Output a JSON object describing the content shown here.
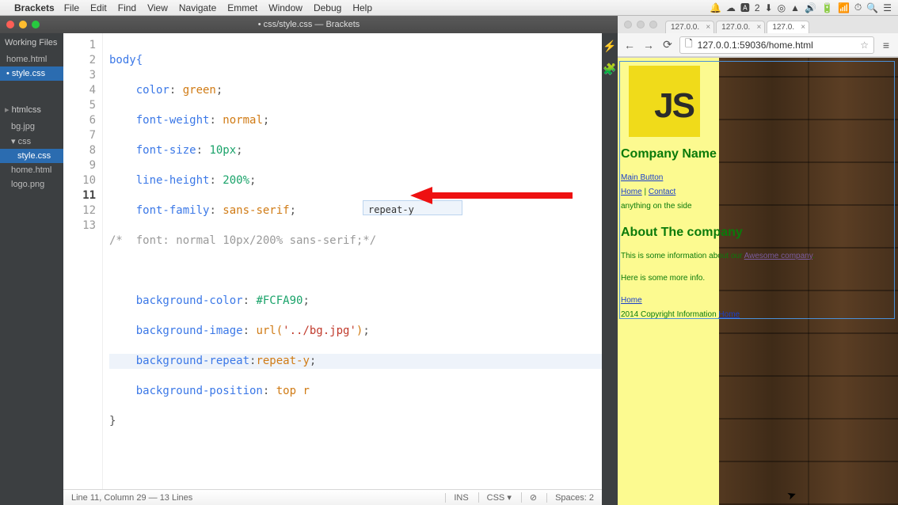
{
  "menubar": {
    "appname": "Brackets",
    "items": [
      "File",
      "Edit",
      "Find",
      "View",
      "Navigate",
      "Emmet",
      "Window",
      "Debug",
      "Help"
    ]
  },
  "window": {
    "title": "• css/style.css — Brackets"
  },
  "sidebar": {
    "working_heading": "Working Files",
    "working": [
      {
        "label": "home.html",
        "active": false
      },
      {
        "label": "style.css",
        "active": true
      }
    ],
    "project_heading": "htmlcss",
    "tree": [
      {
        "label": "bg.jpg"
      },
      {
        "label": "css",
        "folder": true
      },
      {
        "label": "style.css",
        "indent": true,
        "active": true
      },
      {
        "label": "home.html"
      },
      {
        "label": "logo.png"
      }
    ]
  },
  "code": {
    "l1": "body{",
    "l2a": "    color",
    "l2b": ": ",
    "l2c": "green",
    "l2d": ";",
    "l3a": "    font-weight",
    "l3b": ": ",
    "l3c": "normal",
    "l3d": ";",
    "l4a": "    font-size",
    "l4b": ": ",
    "l4c": "10px",
    "l4d": ";",
    "l5a": "    line-height",
    "l5b": ": ",
    "l5c": "200%",
    "l5d": ";",
    "l6a": "    font-family",
    "l6b": ": ",
    "l6c": "sans-serif",
    "l6d": ";",
    "l7": "/*  font: normal 10px/200% sans-serif;*/",
    "l9a": "    background-color",
    "l9b": ": ",
    "l9c": "#FCFA90",
    "l9d": ";",
    "l10a": "    background-image",
    "l10b": ": ",
    "l10c": "url(",
    "l10d": "'../bg.jpg'",
    "l10e": ")",
    "l10f": ";",
    "l11a": "    background-repeat",
    "l11b": ":",
    "l11c": "repeat-y",
    "l11d": ";",
    "l12a": "    background-position",
    "l12b": ": ",
    "l12c": "top r",
    "l13": "}"
  },
  "suggest": {
    "text": "repeat-y"
  },
  "status": {
    "left": "Line 11, Column 29 — 13 Lines",
    "ins": "INS",
    "lang": "CSS",
    "spaces": "Spaces: 2"
  },
  "chrome": {
    "tabs": [
      {
        "label": "127.0.0."
      },
      {
        "label": "127.0.0."
      },
      {
        "label": "127.0."
      }
    ],
    "url": "127.0.0.1:59036/home.html"
  },
  "page": {
    "js": "JS",
    "company": "Company Name",
    "main_button": "Main Button",
    "home": "Home",
    "contact": "Contact",
    "side": "anything on the side",
    "about": "About The company",
    "info": "This is some information about our ",
    "awesome": "Awesome company",
    "more": "Here is some more info.",
    "footer_home": "Home",
    "copyright": "2014 Copyright Information ",
    "copyright_link": "Home"
  }
}
